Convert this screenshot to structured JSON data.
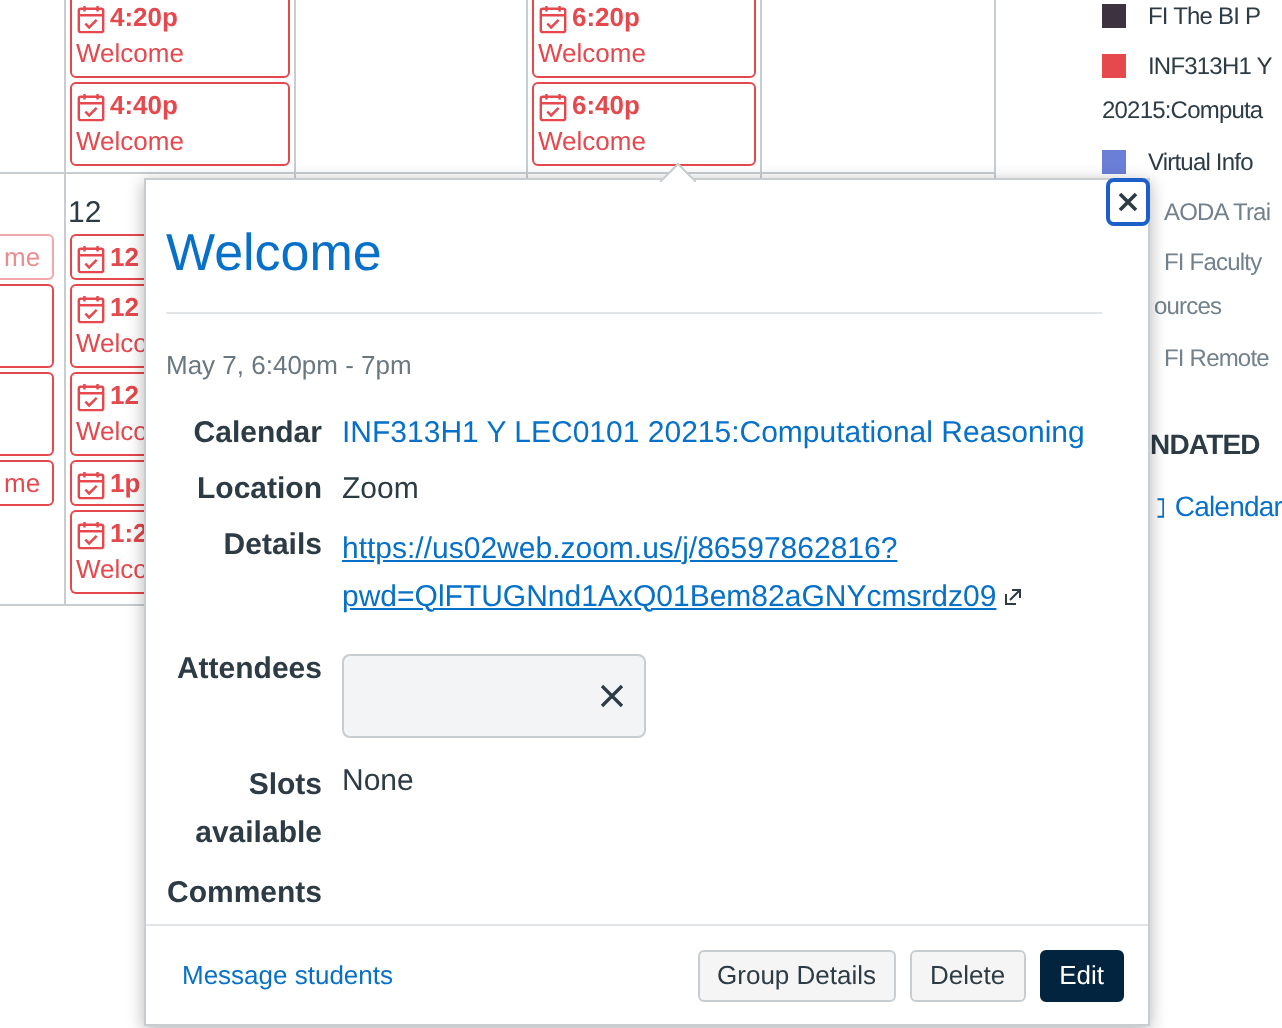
{
  "calendar": {
    "rows": [
      {
        "cells": [
          {},
          {
            "events": [
              {
                "kind": "tall",
                "time": "4:20p",
                "title": "Welcome",
                "faded": false
              },
              {
                "kind": "tall",
                "time": "4:40p",
                "title": "Welcome",
                "faded": false
              }
            ]
          },
          {},
          {
            "events": [
              {
                "kind": "tall",
                "time": "6:20p",
                "title": "Welcome",
                "faded": false
              },
              {
                "kind": "tall",
                "time": "6:40p",
                "title": "Welcome",
                "faded": false
              }
            ]
          },
          {}
        ]
      },
      {
        "cells": [
          {
            "events": [
              {
                "kind": "short",
                "title": "me",
                "faded": true
              },
              {
                "kind": "tall",
                "faded": false
              },
              {
                "kind": "tall",
                "faded": false
              },
              {
                "kind": "short",
                "title": "me",
                "faded": false
              }
            ]
          },
          {
            "day": "12",
            "events": [
              {
                "kind": "short",
                "time": "12",
                "faded": false
              },
              {
                "kind": "tall",
                "time": "12",
                "title": "Welco",
                "faded": false
              },
              {
                "kind": "tall",
                "time": "12",
                "title": "Welco",
                "faded": false
              },
              {
                "kind": "short",
                "time": "1p",
                "faded": false
              },
              {
                "kind": "tall",
                "time": "1:2",
                "title": "Welco",
                "faded": false
              }
            ]
          },
          {},
          {},
          {}
        ]
      }
    ]
  },
  "sidebar": {
    "calendars": [
      {
        "lines": [
          "FI The BI P"
        ],
        "color": "#3d3340",
        "enabled": true
      },
      {
        "lines": [
          "INF313H1 Y",
          "20215:Computa"
        ],
        "color": "#e5484d",
        "enabled": true
      },
      {
        "lines": [
          "Virtual Info"
        ],
        "color": "#6b7fd7",
        "enabled": true
      },
      {
        "lines": [
          "AODA Trai"
        ],
        "enabled": false
      },
      {
        "lines": [
          "FI Faculty",
          "ources"
        ],
        "enabled": false
      },
      {
        "lines": [
          "FI Remote"
        ],
        "enabled": false
      }
    ],
    "heading": "NDATED",
    "link": "Calendar"
  },
  "popup": {
    "title": "Welcome",
    "date": "May 7, 6:40pm - 7pm",
    "fields": [
      {
        "kind": "link",
        "label": "Calendar",
        "value": "INF313H1 Y LEC0101 20215:Computational Reasoning"
      },
      {
        "kind": "text",
        "label": "Location",
        "value": "Zoom"
      },
      {
        "kind": "url",
        "label": "Details",
        "lines": [
          "https://us02web.zoom.us/j/86597862816?",
          "pwd=QlFTUGNnd1AxQ01Bem82aGNYcmsrdz09"
        ]
      },
      {
        "kind": "attendees",
        "label": "Attendees"
      },
      {
        "kind": "text",
        "label": "Slots available",
        "value": "None"
      },
      {
        "kind": "empty",
        "label": "Comments"
      }
    ],
    "footer_link": "Message students",
    "buttons": [
      {
        "label": "Group Details",
        "primary": false
      },
      {
        "label": "Delete",
        "primary": false
      },
      {
        "label": "Edit",
        "primary": true
      }
    ]
  }
}
